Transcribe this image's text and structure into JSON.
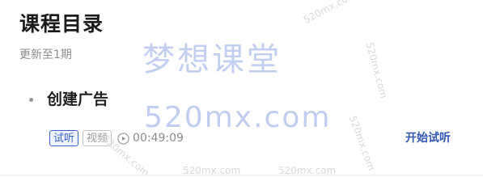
{
  "section": {
    "title": "课程目录",
    "subtitle": "更新至1期"
  },
  "lesson": {
    "title": "创建广告",
    "tags": [
      "试听",
      "视频"
    ],
    "duration": "00:49:09",
    "action": "开始试听"
  },
  "watermark": {
    "main": "梦想课堂",
    "sub": "520mx.com",
    "small": "520mx.com"
  },
  "icons": {
    "play": "play-circle-icon",
    "bullet": "bullet-dot-icon"
  },
  "colors": {
    "accent": "#3a63c9",
    "link": "#2f55b7",
    "muted": "#8c8c8c"
  }
}
